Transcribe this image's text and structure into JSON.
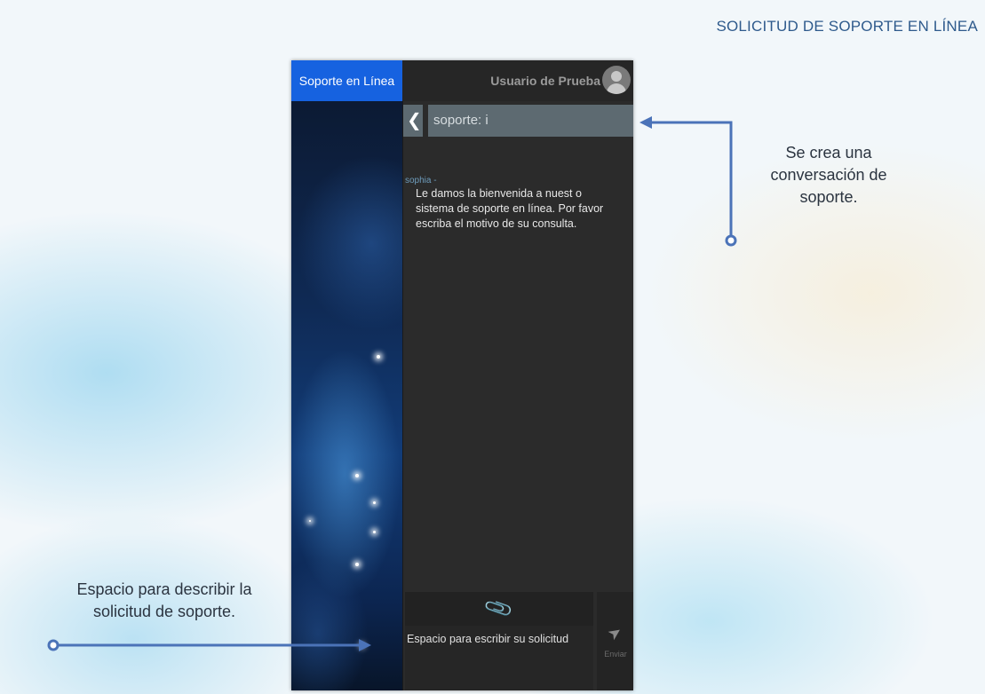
{
  "page_title": "SOLICITUD DE SOPORTE EN LÍNEA",
  "app": {
    "tab_label": "Soporte en Línea",
    "user_name": "Usuario de Prueba"
  },
  "chat": {
    "title": "soporte: i",
    "message": {
      "sender": "sophia -",
      "text": "Le damos la bienvenida a nuest o sistema de soporte en línea. Por favor escriba el motivo de su consulta."
    },
    "input_placeholder": "Espacio para escribir su solicitud",
    "send_label": "Enviar"
  },
  "annotations": {
    "right": [
      "Se crea una",
      "conversación de",
      "soporte."
    ],
    "left": [
      "Espacio para describir la",
      "solicitud de soporte."
    ]
  },
  "icons": {
    "back": "chevron-left-icon",
    "attach": "paperclip-icon",
    "send": "paper-plane-icon",
    "avatar": "user-avatar-icon"
  },
  "colors": {
    "accent_blue": "#1662e0",
    "callout_blue": "#4b73b8",
    "title_blue": "#2e5a8c"
  }
}
